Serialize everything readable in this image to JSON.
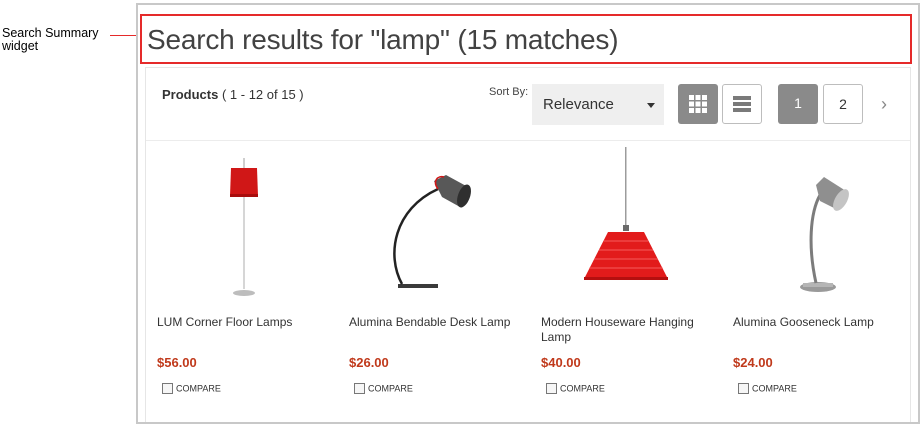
{
  "annotation": {
    "callout_text": "Search Summary widget",
    "line_color": "#e52a2a"
  },
  "summary": {
    "title": "Search results for \"lamp\" (15 matches)"
  },
  "toolbar": {
    "products_label": "Products",
    "products_range": "(  1 - 12 of 15  )",
    "sort_label": "Sort By:",
    "sort_value": "Relevance",
    "view_grid_icon": "grid-view-icon",
    "view_list_icon": "list-view-icon",
    "pages": [
      "1",
      "2"
    ],
    "next_icon": "chevron-right-icon",
    "next_glyph": "›"
  },
  "products": [
    {
      "name": "LUM Corner Floor Lamps",
      "price": "$56.00",
      "compare": "COMPARE",
      "image_icon": "floor-lamp-image"
    },
    {
      "name": "Alumina Bendable Desk Lamp",
      "price": "$26.00",
      "compare": "COMPARE",
      "image_icon": "desk-lamp-image"
    },
    {
      "name": "Modern Houseware Hanging Lamp",
      "price": "$40.00",
      "compare": "COMPARE",
      "image_icon": "hanging-lamp-image"
    },
    {
      "name": "Alumina Gooseneck Lamp",
      "price": "$24.00",
      "compare": "COMPARE",
      "image_icon": "gooseneck-lamp-image"
    }
  ],
  "colors": {
    "accent_red": "#e52a2a",
    "price": "#c0391b",
    "active_button": "#8a8a8a"
  }
}
